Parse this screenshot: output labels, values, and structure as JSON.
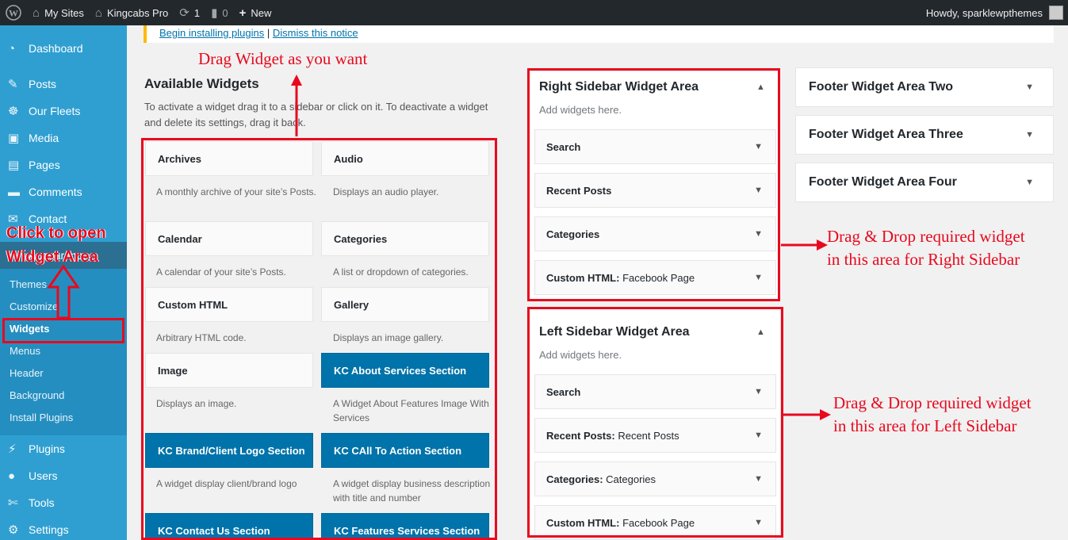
{
  "adminbar": {
    "my_sites": "My Sites",
    "site_name": "Kingcabs Pro",
    "updates_count": "1",
    "comments_count": "0",
    "new_label": "New",
    "howdy": "Howdy, sparklewpthemes"
  },
  "sidebar": {
    "items": [
      {
        "label": "Dashboard",
        "icon": "dashboard-icon"
      },
      {
        "label": "Posts",
        "icon": "pin-icon"
      },
      {
        "label": "Our Fleets",
        "icon": "groups-icon"
      },
      {
        "label": "Media",
        "icon": "media-icon"
      },
      {
        "label": "Pages",
        "icon": "pages-icon"
      },
      {
        "label": "Comments",
        "icon": "comment-icon"
      },
      {
        "label": "Contact",
        "icon": "mail-icon"
      },
      {
        "label": "Appearance",
        "icon": "paintbrush-icon"
      },
      {
        "label": "Plugins",
        "icon": "plugin-icon"
      },
      {
        "label": "Users",
        "icon": "users-icon"
      },
      {
        "label": "Tools",
        "icon": "tools-icon"
      },
      {
        "label": "Settings",
        "icon": "settings-icon"
      }
    ],
    "submenu": [
      "Themes",
      "Customize",
      "Widgets",
      "Menus",
      "Header",
      "Background",
      "Install Plugins"
    ]
  },
  "notice": {
    "link1": "Begin installing plugins",
    "separator": "|",
    "link2": "Dismiss this notice"
  },
  "available": {
    "title": "Available Widgets",
    "description": "To activate a widget drag it to a sidebar or click on it. To deactivate a widget and delete its settings, drag it back.",
    "widgets": [
      {
        "name": "Archives",
        "desc": "A monthly archive of your site’s Posts."
      },
      {
        "name": "Audio",
        "desc": "Displays an audio player."
      },
      {
        "name": "Calendar",
        "desc": "A calendar of your site’s Posts."
      },
      {
        "name": "Categories",
        "desc": "A list or dropdown of categories."
      },
      {
        "name": "Custom HTML",
        "desc": "Arbitrary HTML code."
      },
      {
        "name": "Gallery",
        "desc": "Displays an image gallery."
      },
      {
        "name": "Image",
        "desc": "Displays an image."
      },
      {
        "name": "KC About Services Section",
        "desc": "A Widget About Features Image With Services"
      },
      {
        "name": "KC Brand/Client Logo Section",
        "desc": "A widget display client/brand logo"
      },
      {
        "name": "KC CAll To Action Section",
        "desc": "A widget display business description with title and number"
      },
      {
        "name": "KC Contact Us Section",
        "desc": ""
      },
      {
        "name": "KC Features Services Section",
        "desc": ""
      }
    ]
  },
  "right_sidebar": {
    "title": "Right Sidebar Widget Area",
    "subtitle": "Add widgets here.",
    "widgets": [
      {
        "name": "Search",
        "instance": ""
      },
      {
        "name": "Recent Posts",
        "instance": ""
      },
      {
        "name": "Categories",
        "instance": ""
      },
      {
        "name": "Custom HTML:",
        "instance": "Facebook Page"
      }
    ]
  },
  "left_sidebar": {
    "title": "Left Sidebar Widget Area",
    "subtitle": "Add widgets here.",
    "widgets": [
      {
        "name": "Search",
        "instance": ""
      },
      {
        "name": "Recent Posts:",
        "instance": "Recent Posts"
      },
      {
        "name": "Categories:",
        "instance": "Categories"
      },
      {
        "name": "Custom HTML:",
        "instance": "Facebook Page"
      }
    ]
  },
  "footer_areas": [
    "Footer Widget Area Two",
    "Footer Widget Area Three",
    "Footer Widget Area Four"
  ],
  "annotations": {
    "drag_widget": "Drag Widget as you want",
    "click_open_line1": "Click to open",
    "click_open_line2": "Widget Area",
    "right_line1": "Drag & Drop required widget",
    "right_line2": "in this area for Right Sidebar",
    "left_line1": "Drag & Drop required widget",
    "left_line2": "in this area for Left Sidebar"
  },
  "colors": {
    "accent": "#0073aa",
    "annotation_red": "#e8091e",
    "sidebar_bg": "#2f9fd1",
    "adminbar_bg": "#23282d"
  }
}
